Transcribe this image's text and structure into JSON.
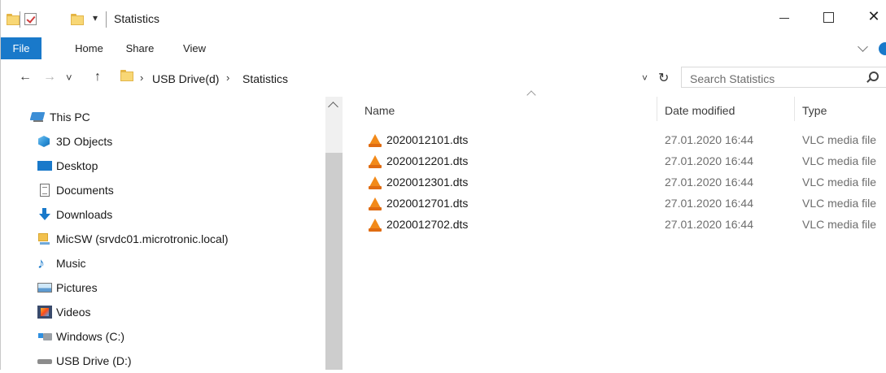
{
  "window": {
    "title": "Statistics",
    "controls": {
      "minimize_icon": "minimize-icon",
      "maximize_icon": "maximize-icon",
      "close_glyph": "✕"
    }
  },
  "quick_access": {
    "dropdown_glyph": "▾"
  },
  "ribbon": {
    "tabs": [
      "File",
      "Home",
      "Share",
      "View"
    ],
    "accent": "#1979ca"
  },
  "navigation": {
    "back_glyph": "←",
    "forward_glyph": "→",
    "recent_glyph": "˅",
    "up_glyph": "↑",
    "breadcrumb": [
      "USB Drive(d)",
      "Statistics"
    ],
    "breadcrumb_sep": "›",
    "address_dropdown_glyph": "˅",
    "refresh_glyph": "↻",
    "search_placeholder": "Search Statistics"
  },
  "nav_pane": {
    "items": [
      {
        "label": "This PC",
        "icon": "this-pc-icon"
      },
      {
        "label": "3D Objects",
        "icon": "3d-objects-icon"
      },
      {
        "label": "Desktop",
        "icon": "desktop-icon"
      },
      {
        "label": "Documents",
        "icon": "documents-icon"
      },
      {
        "label": "Downloads",
        "icon": "downloads-icon"
      },
      {
        "label": "MicSW (srvdc01.microtronic.local)",
        "icon": "network-drive-icon"
      },
      {
        "label": "Music",
        "icon": "music-icon"
      },
      {
        "label": "Pictures",
        "icon": "pictures-icon"
      },
      {
        "label": "Videos",
        "icon": "videos-icon"
      },
      {
        "label": "Windows (C:)",
        "icon": "windows-drive-icon"
      },
      {
        "label": "USB Drive (D:)",
        "icon": "usb-drive-icon"
      }
    ]
  },
  "file_list": {
    "columns": [
      "Name",
      "Date modified",
      "Type"
    ],
    "rows": [
      {
        "name": "2020012101.dts",
        "date": "27.01.2020 16:44",
        "type": "VLC media file"
      },
      {
        "name": "2020012201.dts",
        "date": "27.01.2020 16:44",
        "type": "VLC media file"
      },
      {
        "name": "2020012301.dts",
        "date": "27.01.2020 16:44",
        "type": "VLC media file"
      },
      {
        "name": "2020012701.dts",
        "date": "27.01.2020 16:44",
        "type": "VLC media file"
      },
      {
        "name": "2020012702.dts",
        "date": "27.01.2020 16:44",
        "type": "VLC media file"
      }
    ]
  }
}
